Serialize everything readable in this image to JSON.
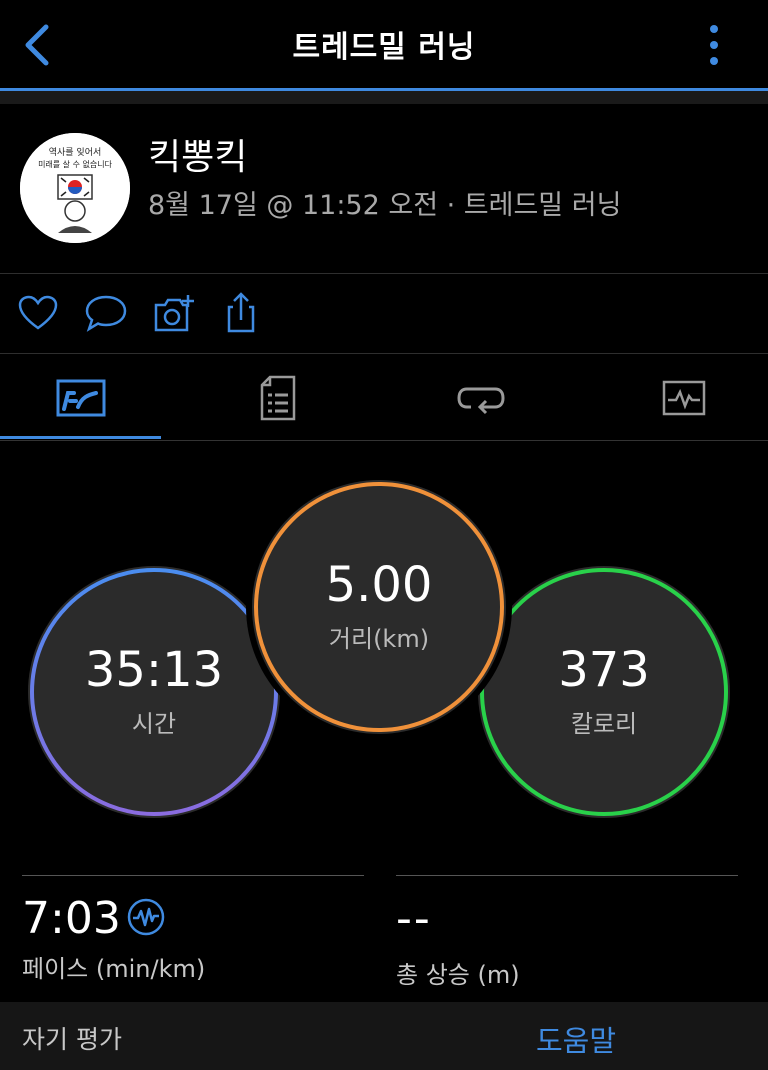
{
  "header": {
    "title": "트레드밀 러닝",
    "back_icon": "chevron-left-icon",
    "menu_icon": "more-vertical-icon"
  },
  "profile": {
    "username": "킥뽕킥",
    "subtitle": "8월 17일 @ 11:52 오전 · 트레드밀 러닝",
    "avatar_text_line1": "역사를 잊어서",
    "avatar_text_line2": "미래를 살 수 없습니다"
  },
  "actions": [
    "heart-icon",
    "comment-icon",
    "camera-plus-icon",
    "share-icon"
  ],
  "tabs": [
    "stats-tab-icon",
    "details-tab-icon",
    "laps-tab-icon",
    "chart-tab-icon"
  ],
  "metrics": {
    "time": {
      "value": "35:13",
      "label": "시간"
    },
    "distance": {
      "value": "5.00",
      "label": "거리(km)"
    },
    "calories": {
      "value": "373",
      "label": "칼로리"
    }
  },
  "stats": {
    "pace": {
      "value": "7:03",
      "label": "페이스 (min/km)"
    },
    "ascent": {
      "value": "--",
      "label": "총 상승 (m)"
    }
  },
  "bottom": {
    "left_label": "자기 평가",
    "right_label": "도움말"
  },
  "colors": {
    "accent": "#3f8ae0",
    "distance": "#f0913a",
    "calories": "#29d14a",
    "time_top": "#4a8df0",
    "time_bottom": "#8a6ce0"
  }
}
